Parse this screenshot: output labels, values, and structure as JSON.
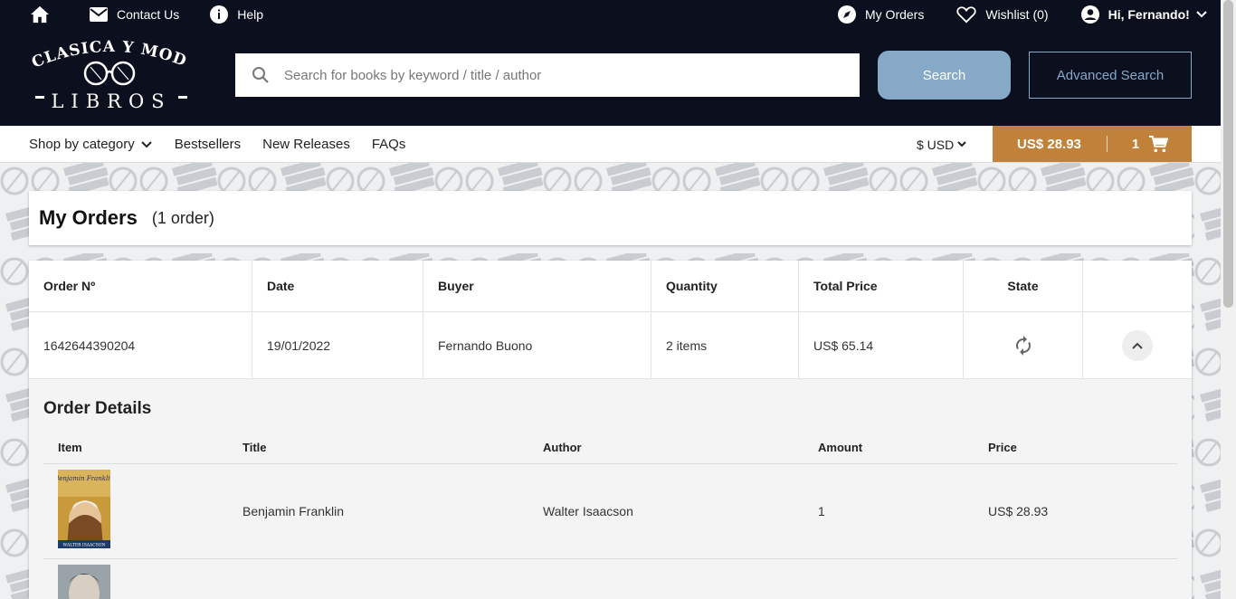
{
  "header": {
    "top_left": [
      {
        "icon": "home-icon",
        "label": ""
      },
      {
        "icon": "mail-icon",
        "label": "Contact Us"
      },
      {
        "icon": "info-icon",
        "label": "Help"
      }
    ],
    "top_right": {
      "orders_label": "My Orders",
      "wishlist_label": "Wishlist (0)",
      "user_label": "Hi, Fernando!"
    },
    "logo": {
      "line1": "CLASICA Y MODERNA",
      "line2": "LIBROS"
    },
    "search": {
      "placeholder": "Search for books by keyword / title / author",
      "button_label": "Search",
      "advanced_label": "Advanced Search"
    }
  },
  "nav": {
    "category_label": "Shop by category",
    "bestsellers_label": "Bestsellers",
    "new_releases_label": "New Releases",
    "faqs_label": "FAQs",
    "currency_label": "$ USD"
  },
  "cart": {
    "total": "US$ 28.93",
    "count": "1"
  },
  "page": {
    "title": "My Orders",
    "subtitle": "(1 order)"
  },
  "orders_table": {
    "headers": [
      "Order Nº",
      "Date",
      "Buyer",
      "Quantity",
      "Total Price",
      "State",
      ""
    ],
    "rows": [
      {
        "order_no": "1642644390204",
        "date": "19/01/2022",
        "buyer": "Fernando Buono",
        "quantity": "2 items",
        "total": "US$ 65.14",
        "state_icon": "sync-icon"
      }
    ]
  },
  "order_details": {
    "title": "Order Details",
    "headers": [
      "Item",
      "Title",
      "Author",
      "Amount",
      "Price"
    ],
    "rows": [
      {
        "title": "Benjamin Franklin",
        "author": "Walter Isaacson",
        "amount": "1",
        "price": "US$ 28.93",
        "cover_text": "Benjamin Franklin",
        "cover_author": "WALTER ISAACSON"
      },
      {
        "title": "",
        "author": "",
        "amount": "",
        "price": ""
      }
    ]
  },
  "colors": {
    "header_bg": "#0b0f1e",
    "accent_blue": "#86a9c8",
    "cart_orange": "#c0813a"
  }
}
